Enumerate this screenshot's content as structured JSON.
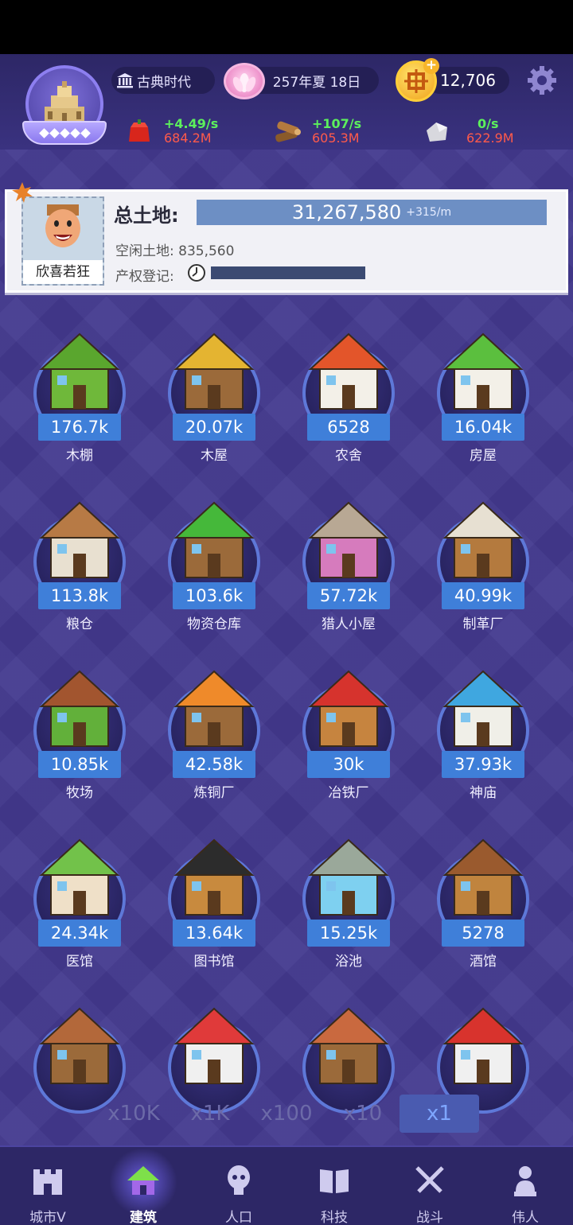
{
  "header": {
    "era": "古典时代",
    "date": "257年夏 18日",
    "coins": "12,706",
    "resources": [
      {
        "icon": "food-icon",
        "rate": "+4.49/s",
        "total": "684.2M"
      },
      {
        "icon": "wood-icon",
        "rate": "+107/s",
        "total": "605.3M"
      },
      {
        "icon": "stone-icon",
        "rate": "0/s",
        "total": "622.9M"
      }
    ]
  },
  "land": {
    "leader_name": "欣喜若狂",
    "title": "总土地:",
    "total": "31,267,580",
    "rate": "+315/m",
    "idle": "空闲土地: 835,560",
    "registration": "产权登记:"
  },
  "buildings": [
    {
      "label": "木棚",
      "count": "176.7k",
      "color": "#6fb83a",
      "roof": "#5aa62e"
    },
    {
      "label": "木屋",
      "count": "20.07k",
      "color": "#9b6a3a",
      "roof": "#e4b431"
    },
    {
      "label": "农舍",
      "count": "6528",
      "color": "#f3f0e8",
      "roof": "#e3552a"
    },
    {
      "label": "房屋",
      "count": "16.04k",
      "color": "#f3f0e8",
      "roof": "#5bbf3e"
    },
    {
      "label": "粮仓",
      "count": "113.8k",
      "color": "#e8e0d0",
      "roof": "#b77a45"
    },
    {
      "label": "物资仓库",
      "count": "103.6k",
      "color": "#9b6a3a",
      "roof": "#45b83a"
    },
    {
      "label": "猎人小屋",
      "count": "57.72k",
      "color": "#d67bbd",
      "roof": "#b8a894"
    },
    {
      "label": "制革厂",
      "count": "40.99k",
      "color": "#b47a3e",
      "roof": "#e7e0d2"
    },
    {
      "label": "牧场",
      "count": "10.85k",
      "color": "#62b03a",
      "roof": "#a2552f"
    },
    {
      "label": "炼铜厂",
      "count": "42.58k",
      "color": "#9b6a3a",
      "roof": "#ef8a2a"
    },
    {
      "label": "冶铁厂",
      "count": "30k",
      "color": "#c6843f",
      "roof": "#d6332d"
    },
    {
      "label": "神庙",
      "count": "37.93k",
      "color": "#f0efe8",
      "roof": "#3fa7e0"
    },
    {
      "label": "医馆",
      "count": "24.34k",
      "color": "#efe0c8",
      "roof": "#72c24a"
    },
    {
      "label": "图书馆",
      "count": "13.64k",
      "color": "#c88a3e",
      "roof": "#2c2c2c"
    },
    {
      "label": "浴池",
      "count": "15.25k",
      "color": "#7ed0f0",
      "roof": "#9aa89a"
    },
    {
      "label": "酒馆",
      "count": "5278",
      "color": "#c0843e",
      "roof": "#9a5a2e"
    },
    {
      "label": "",
      "count": "",
      "color": "#9b6a3a",
      "roof": "#b3683a"
    },
    {
      "label": "",
      "count": "",
      "color": "#f0f0f0",
      "roof": "#e03a3a"
    },
    {
      "label": "",
      "count": "",
      "color": "#9b6a3a",
      "roof": "#c9693f"
    },
    {
      "label": "",
      "count": "",
      "color": "#f0f0f0",
      "roof": "#d8332d"
    }
  ],
  "multipliers": [
    "x10K",
    "x1K",
    "x100",
    "x10",
    "x1"
  ],
  "active_multiplier": "x1",
  "nav": [
    {
      "label": "城市V",
      "icon": "city-icon"
    },
    {
      "label": "建筑",
      "icon": "build-icon"
    },
    {
      "label": "人口",
      "icon": "population-icon"
    },
    {
      "label": "科技",
      "icon": "tech-book-icon"
    },
    {
      "label": "战斗",
      "icon": "battle-swords-icon"
    },
    {
      "label": "伟人",
      "icon": "great-person-icon"
    }
  ],
  "active_nav": "建筑"
}
